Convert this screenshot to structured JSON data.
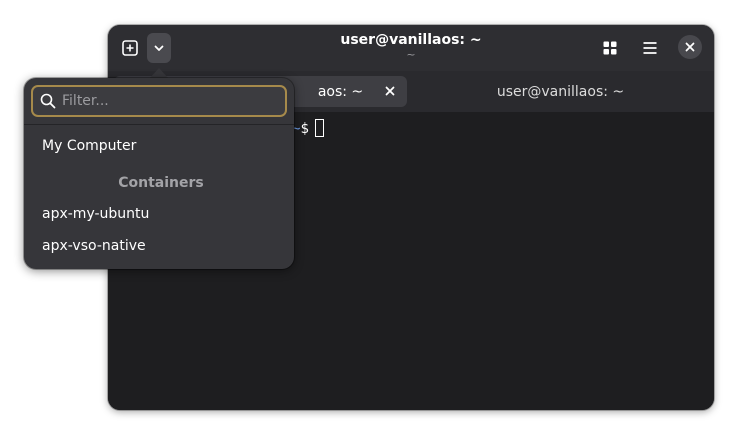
{
  "window": {
    "title": "user@vanillaos: ~",
    "subtitle": "~"
  },
  "tabs": [
    {
      "label": "user@vanillaos: ~",
      "visible_label": "aos: ~",
      "active": true
    },
    {
      "label": "user@vanillaos: ~",
      "active": false
    }
  ],
  "terminal": {
    "prompt_path": "~",
    "prompt_symbol": "$"
  },
  "popover": {
    "search_placeholder": "Filter...",
    "items": [
      {
        "label": "My Computer"
      }
    ],
    "containers_heading": "Containers",
    "containers": [
      {
        "label": "apx-my-ubuntu"
      },
      {
        "label": "apx-vso-native"
      }
    ]
  },
  "icons": {
    "new_tab": "plus-square-icon",
    "dropdown": "chevron-down-icon",
    "tabs_overview": "grid-icon",
    "menu": "hamburger-menu-icon",
    "close": "close-icon",
    "search": "search-icon"
  },
  "colors": {
    "accent_focus": "#a68a4b",
    "headerbar": "#2e2e32",
    "terminal_bg": "#1e1e20",
    "prompt_path": "#6e9ee8"
  }
}
